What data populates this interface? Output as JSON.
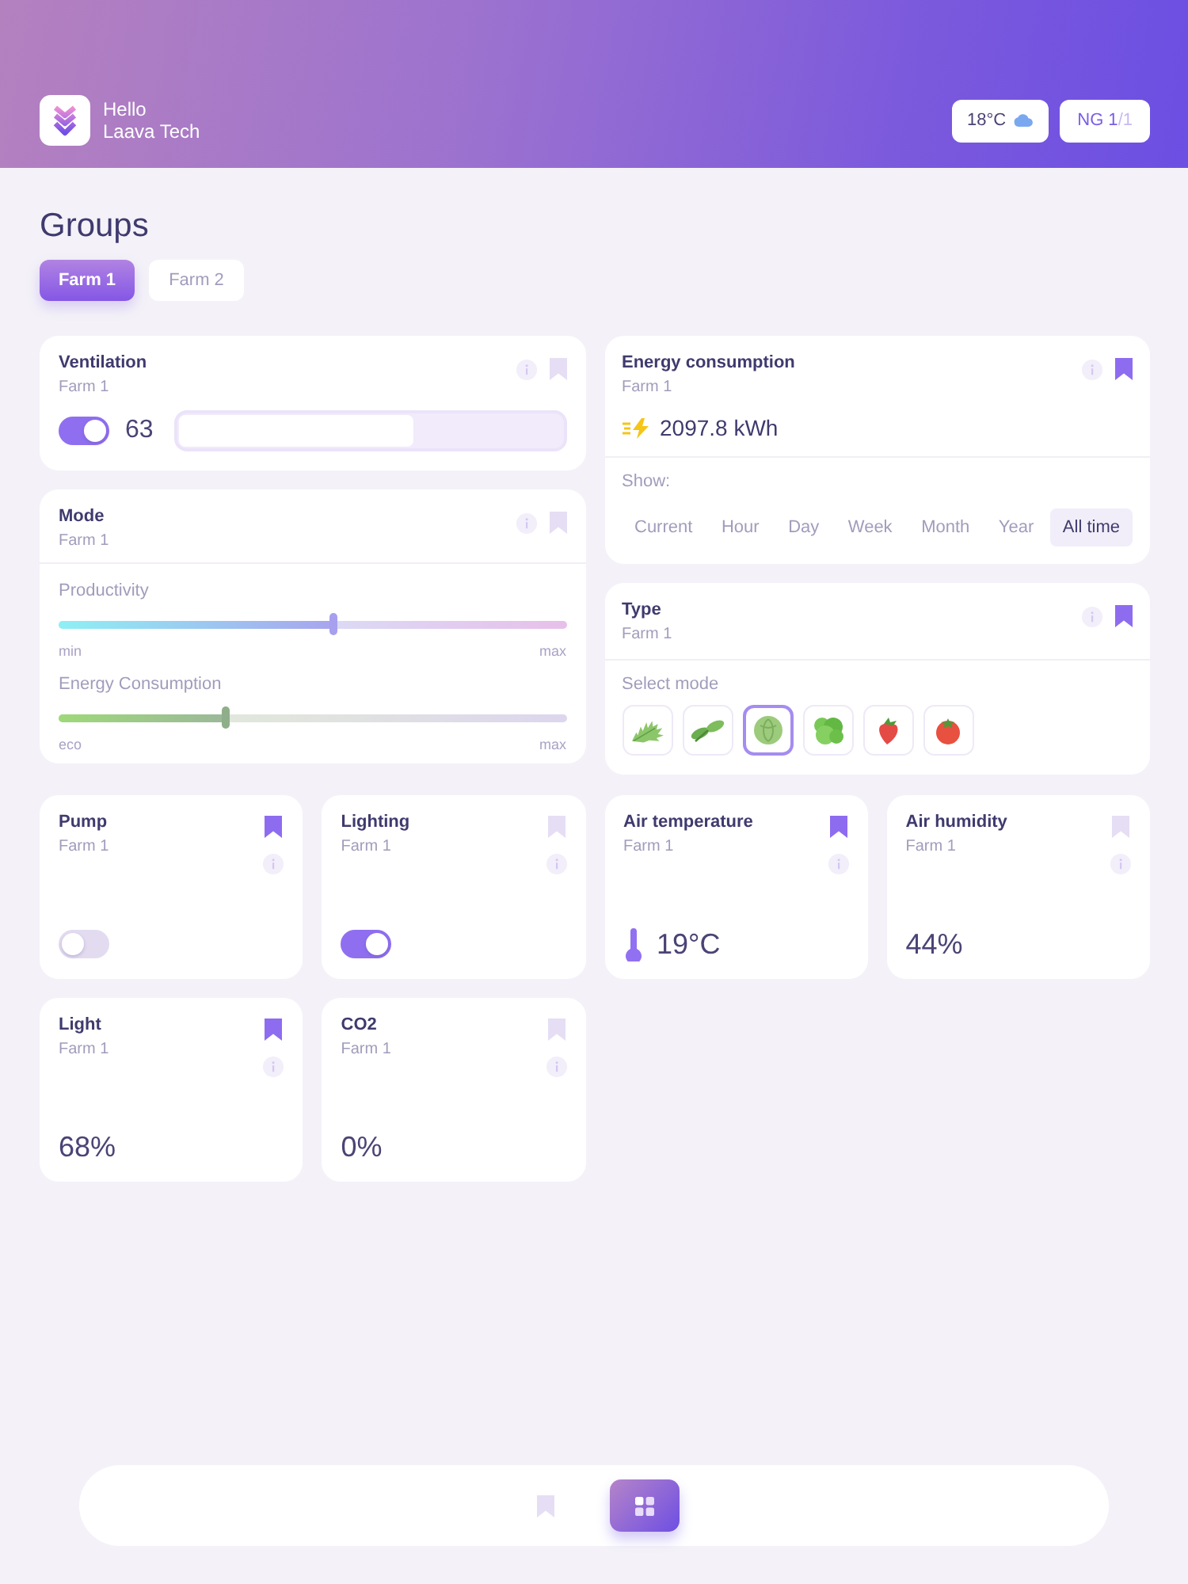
{
  "header": {
    "greeting": "Hello",
    "user": "Laava Tech",
    "weather": {
      "temperature": "18°C"
    },
    "group_badge": {
      "current": "NG 1",
      "total": "/1"
    }
  },
  "page_title": "Groups",
  "tabs": [
    {
      "label": "Farm 1",
      "selected": true
    },
    {
      "label": "Farm 2",
      "selected": false
    }
  ],
  "ventilation": {
    "title": "Ventilation",
    "subtitle": "Farm 1",
    "bookmarked": false,
    "on": true,
    "value": "63",
    "level": 0.63
  },
  "mode": {
    "title": "Mode",
    "subtitle": "Farm 1",
    "bookmarked": false,
    "sliders": [
      {
        "kind": "productivity",
        "label": "Productivity",
        "level": 0.54,
        "min_label": "min",
        "max_label": "max"
      },
      {
        "kind": "energy",
        "label": "Energy Consumption",
        "level": 0.33,
        "min_label": "eco",
        "max_label": "max"
      }
    ]
  },
  "energy": {
    "title": "Energy consumption",
    "subtitle": "Farm 1",
    "bookmarked": true,
    "value": "2097.8 kWh",
    "show_label": "Show:",
    "periods": [
      {
        "label": "Current",
        "selected": false
      },
      {
        "label": "Hour",
        "selected": false
      },
      {
        "label": "Day",
        "selected": false
      },
      {
        "label": "Week",
        "selected": false
      },
      {
        "label": "Month",
        "selected": false
      },
      {
        "label": "Year",
        "selected": false
      },
      {
        "label": "All time",
        "selected": true
      }
    ]
  },
  "type": {
    "title": "Type",
    "subtitle": "Farm 1",
    "bookmarked": true,
    "select_label": "Select mode",
    "modes": [
      {
        "kind": "arugula",
        "selected": false
      },
      {
        "kind": "basil",
        "selected": false
      },
      {
        "kind": "cabbage",
        "selected": true
      },
      {
        "kind": "lettuce",
        "selected": false
      },
      {
        "kind": "strawberry",
        "selected": false
      },
      {
        "kind": "tomato",
        "selected": false
      }
    ]
  },
  "tiles": [
    {
      "kind": "toggle",
      "title": "Pump",
      "subtitle": "Farm 1",
      "bookmarked": true,
      "on": false
    },
    {
      "kind": "toggle",
      "title": "Lighting",
      "subtitle": "Farm 1",
      "bookmarked": false,
      "on": true
    },
    {
      "kind": "temperature",
      "title": "Air temperature",
      "subtitle": "Farm 1",
      "bookmarked": true,
      "value": "19°C"
    },
    {
      "kind": "reading",
      "title": "Air humidity",
      "subtitle": "Farm 1",
      "bookmarked": false,
      "value": "44%"
    },
    {
      "kind": "reading",
      "title": "Light",
      "subtitle": "Farm 1",
      "bookmarked": true,
      "value": "68%"
    },
    {
      "kind": "reading",
      "title": "CO2",
      "subtitle": "Farm 1",
      "bookmarked": false,
      "value": "0%"
    }
  ],
  "bottom_nav": [
    {
      "kind": "bookmarks",
      "selected": false
    },
    {
      "kind": "grid",
      "selected": true
    }
  ]
}
